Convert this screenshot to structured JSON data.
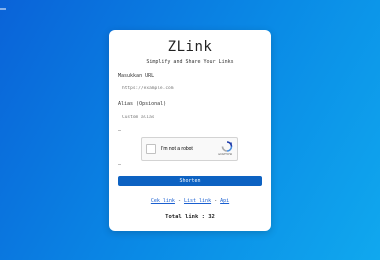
{
  "app": {
    "title": "ZLink",
    "subtitle": "Simplify and Share Your Links"
  },
  "form": {
    "url_label": "Masukkan URL",
    "url_placeholder": "https://example.com",
    "alias_label": "Alias (Opsional)",
    "alias_placeholder": "Custom alias",
    "dash_top": "–",
    "dash_bottom": "–",
    "shorten_label": "Shorten"
  },
  "captcha": {
    "label": "I'm not a robot",
    "brand": "reCAPTCHA",
    "terms": "Privacy - Terms"
  },
  "footer": {
    "cek_link": "Cek link",
    "list_link": "List link",
    "api": "Api",
    "separator": "-",
    "total": "Total link : 32"
  },
  "colors": {
    "button": "#0d62c2",
    "link": "#1a5fd0",
    "background_start": "#0a63d8",
    "background_end": "#10a8ee"
  }
}
